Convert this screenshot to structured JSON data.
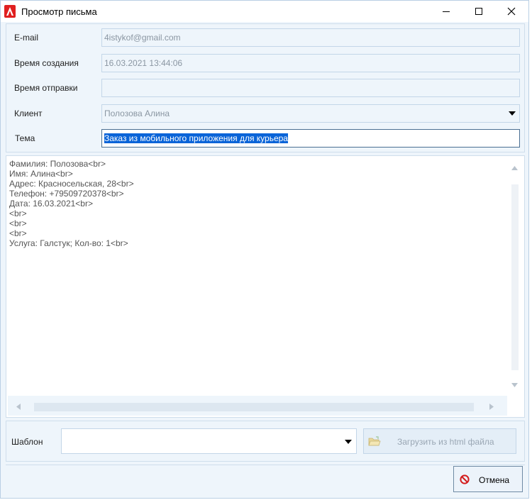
{
  "window": {
    "title": "Просмотр письма",
    "accent_color": "#e02020"
  },
  "fields": [
    {
      "label": "E-mail",
      "value": "4istykof@gmail.com",
      "type": "text"
    },
    {
      "label": "Время создания",
      "value": "16.03.2021 13:44:06",
      "type": "text"
    },
    {
      "label": "Время отправки",
      "value": "",
      "type": "text"
    },
    {
      "label": "Клиент",
      "value": "Полозова Алина",
      "type": "select"
    },
    {
      "label": "Тема",
      "value": "Заказ из мобильного приложения для курьера",
      "type": "text-active-selected"
    }
  ],
  "body": {
    "text": "Фамилия: Полозова<br>\nИмя: Алина<br>\nАдрес: Красносельская, 28<br>\nТелефон: +79509720378<br>\nДата: 16.03.2021<br>\n<br>\n<br>\n<br>\nУслуга: Галстук; Кол-во: 1<br>"
  },
  "template": {
    "label": "Шаблон",
    "selected": "",
    "load_button_label": "Загрузить из html файла",
    "load_button_enabled": false
  },
  "actions": {
    "cancel_label": "Отмена"
  },
  "icons": {
    "app": "app-logo-icon",
    "minimize": "minimize-icon",
    "maximize": "maximize-icon",
    "close": "close-icon",
    "combo": "chevron-down-icon",
    "load": "folder-open-icon",
    "cancel": "cancel-icon"
  }
}
